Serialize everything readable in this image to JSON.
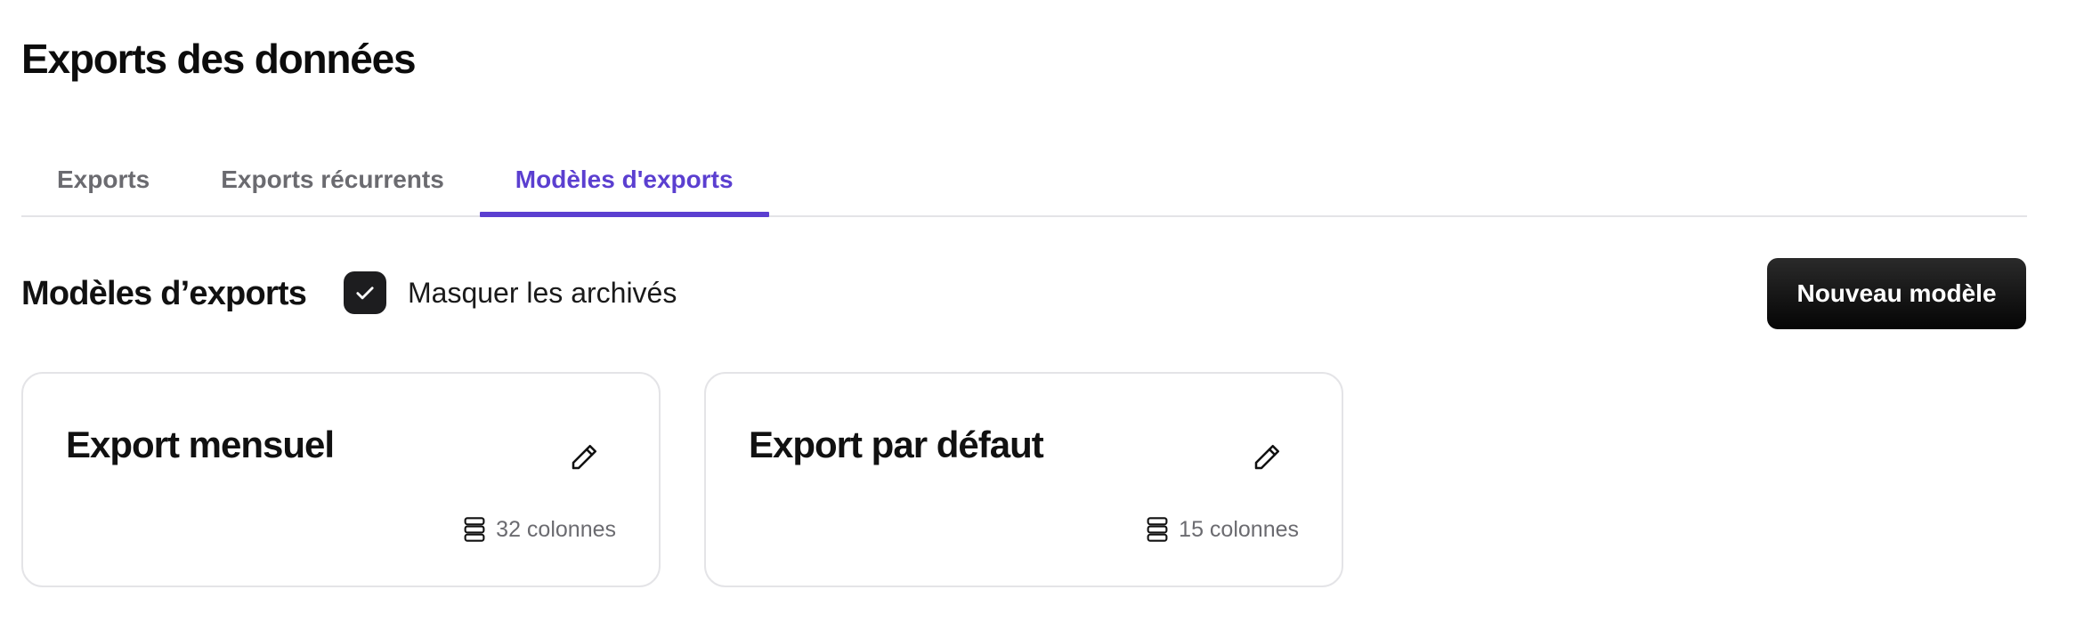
{
  "page": {
    "title": "Exports des données"
  },
  "tabs": [
    {
      "label": "Exports",
      "active": false
    },
    {
      "label": "Exports récurrents",
      "active": false
    },
    {
      "label": "Modèles d'exports",
      "active": true
    }
  ],
  "section": {
    "title": "Modèles d’exports",
    "hide_archived": {
      "label": "Masquer les archivés",
      "checked": true
    },
    "new_button_label": "Nouveau modèle"
  },
  "templates": [
    {
      "name": "Export mensuel",
      "columns": "32 colonnes",
      "edit_icon": "pencil-icon",
      "columns_icon": "stack-icon"
    },
    {
      "name": "Export par défaut",
      "columns": "15 colonnes",
      "edit_icon": "pencil-icon",
      "columns_icon": "stack-icon"
    }
  ],
  "colors": {
    "accent": "#5b3fd0",
    "button": "#111111",
    "border": "#e4e4e7",
    "muted": "#6b6b70"
  }
}
